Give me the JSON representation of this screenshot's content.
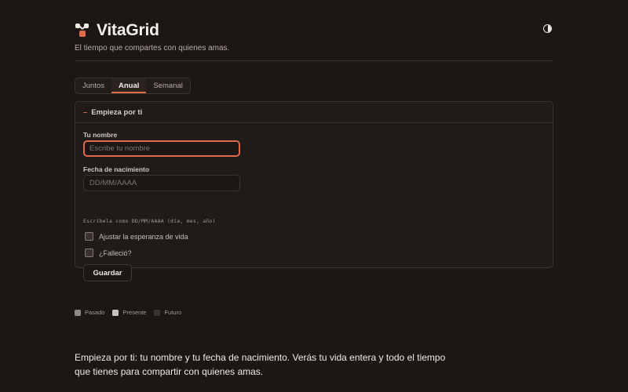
{
  "header": {
    "brand": "VitaGrid",
    "tagline": "El tiempo que compartes con quienes amas.",
    "theme_icon": "contrast-icon"
  },
  "tabs": [
    {
      "label": "Juntos",
      "active": false
    },
    {
      "label": "Anual",
      "active": true
    },
    {
      "label": "Semanal",
      "active": false
    }
  ],
  "panel": {
    "title": "Empieza por ti",
    "title_prefix": "–",
    "name_label": "Tu nombre",
    "name_placeholder": "Escribe tu nombre",
    "name_value": "",
    "birth_label": "Fecha de nacimiento",
    "birth_placeholder": "DD/MM/AAAA",
    "birth_value": "",
    "birth_hint": "Escríbela como DD/MM/AAAA (día, mes, año)",
    "checkboxes": [
      {
        "label": "Ajustar la esperanza de vida",
        "checked": false
      },
      {
        "label": "¿Falleció?",
        "checked": false
      }
    ],
    "save_label": "Guardar"
  },
  "legend": [
    {
      "label": "Pasado",
      "color": "#8f8884"
    },
    {
      "label": "Presente",
      "color": "#c9c2bd"
    },
    {
      "label": "Futuro",
      "color": "#3b3431"
    }
  ],
  "description": "Empieza por ti: tu nombre y tu fecha de nacimiento. Verás tu vida entera y todo el tiempo que tienes para compartir con quienes amas.",
  "colors": {
    "background": "#1c1715",
    "accent": "#e0694a",
    "border": "#3a3330"
  }
}
